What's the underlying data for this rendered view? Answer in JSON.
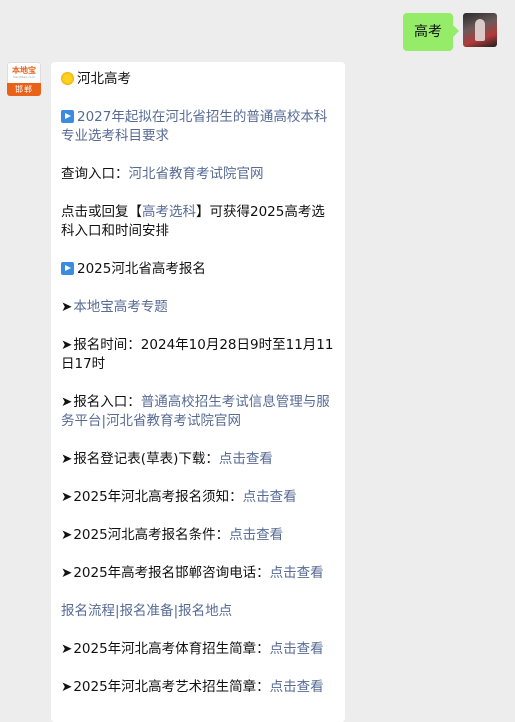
{
  "sent": {
    "text": "高考"
  },
  "bot_avatar": {
    "brand": "本地宝",
    "url": "bendibao.com",
    "city": "邯郸"
  },
  "message": {
    "heading": "河北高考",
    "item1_link": "2027年起拟在河北省招生的普通高校本科专业选考科目要求",
    "query_label": "查询入口：",
    "query_link": "河北省教育考试院官网",
    "reply_prefix": "点击或回复【",
    "reply_keyword": "高考选科",
    "reply_suffix": "】可获得2025高考选科入口和时间安排",
    "section2": "2025河北省高考报名",
    "arrow": "➤",
    "special_link": "本地宝高考专题",
    "reg_time": "报名时间：2024年10月28日9时至11月11日17时",
    "entry_label": "报名入口：",
    "entry_link1": "普通高校招生考试信息管理与服务平台",
    "sep": "|",
    "entry_link2": "河北省教育考试院官网",
    "form_label": "报名登记表(草表)下载：",
    "notice_label": "2025年河北高考报名须知：",
    "cond_label": "2025河北高考报名条件：",
    "phone_label": "2025年高考报名邯郸咨询电话：",
    "click_view": "点击查看",
    "flow_link": "报名流程",
    "prep_link": "报名准备",
    "place_link": "报名地点",
    "sport_label": "2025年河北高考体育招生简章：",
    "art_label": "2025年河北高考艺术招生简章："
  }
}
